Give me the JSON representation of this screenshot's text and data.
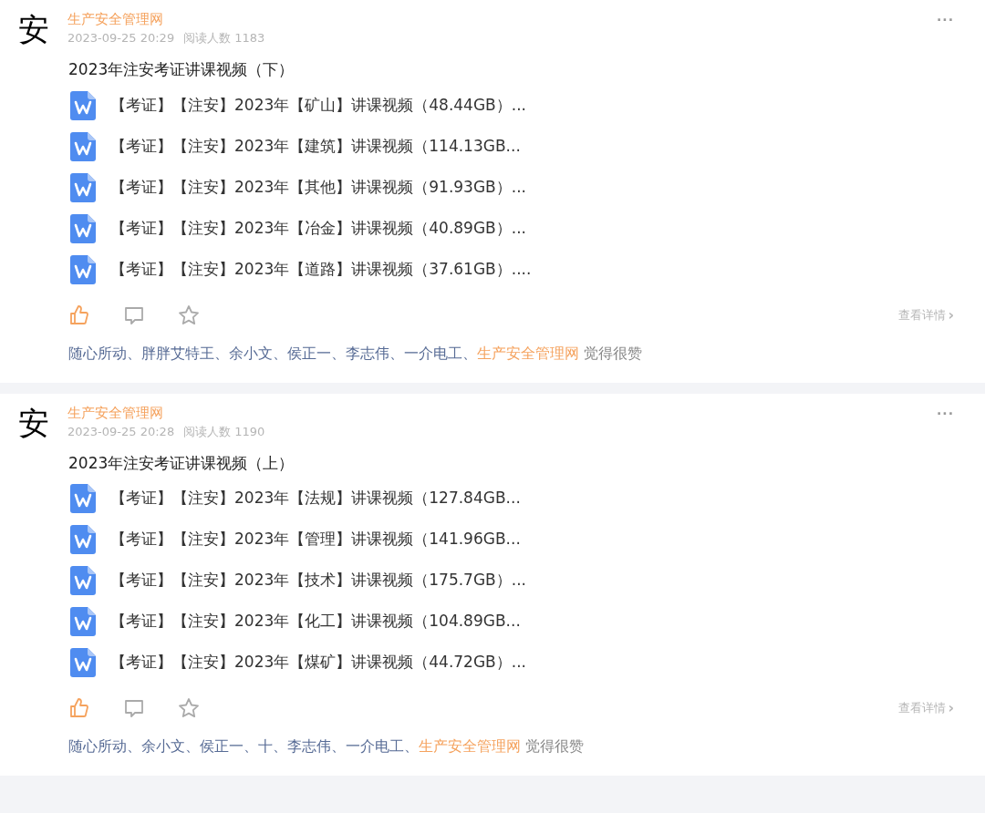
{
  "posts": [
    {
      "avatar": "安",
      "author": "生产安全管理网",
      "time": "2023-09-25 20:29",
      "reads": "阅读人数 1183",
      "more": "...",
      "title": "2023年注安考证讲课视频（下）",
      "files": [
        "【考证】【注安】2023年【矿山】讲课视频（48.44GB）...",
        "【考证】【注安】2023年【建筑】讲课视频（114.13GB...",
        "【考证】【注安】2023年【其他】讲课视频（91.93GB）...",
        "【考证】【注安】2023年【冶金】讲课视频（40.89GB）...",
        "【考证】【注安】2023年【道路】讲课视频（37.61GB）...."
      ],
      "liked": true,
      "details": "查看详情",
      "details_arrow": "›",
      "likers": [
        {
          "name": "随心所动、",
          "highlight": false
        },
        {
          "name": "胖胖艾特王、",
          "highlight": false
        },
        {
          "name": "余小文、",
          "highlight": false
        },
        {
          "name": "侯正一、",
          "highlight": false
        },
        {
          "name": "李志伟、",
          "highlight": false
        },
        {
          "name": "一介电工、",
          "highlight": false
        },
        {
          "name": "生产安全管理网",
          "highlight": true
        }
      ],
      "likes_suffix": "觉得很赞"
    },
    {
      "avatar": "安",
      "author": "生产安全管理网",
      "time": "2023-09-25 20:28",
      "reads": "阅读人数 1190",
      "more": "...",
      "title": "2023年注安考证讲课视频（上）",
      "files": [
        "【考证】【注安】2023年【法规】讲课视频（127.84GB...",
        "【考证】【注安】2023年【管理】讲课视频（141.96GB...",
        "【考证】【注安】2023年【技术】讲课视频（175.7GB）...",
        "【考证】【注安】2023年【化工】讲课视频（104.89GB...",
        "【考证】【注安】2023年【煤矿】讲课视频（44.72GB）..."
      ],
      "liked": true,
      "details": "查看详情",
      "details_arrow": "›",
      "likers": [
        {
          "name": "随心所动、",
          "highlight": false
        },
        {
          "name": "余小文、",
          "highlight": false
        },
        {
          "name": "侯正一、",
          "highlight": false
        },
        {
          "name": "十、",
          "highlight": false
        },
        {
          "name": "李志伟、",
          "highlight": false
        },
        {
          "name": "一介电工、",
          "highlight": false
        },
        {
          "name": "生产安全管理网",
          "highlight": true
        }
      ],
      "likes_suffix": "觉得很赞"
    }
  ]
}
